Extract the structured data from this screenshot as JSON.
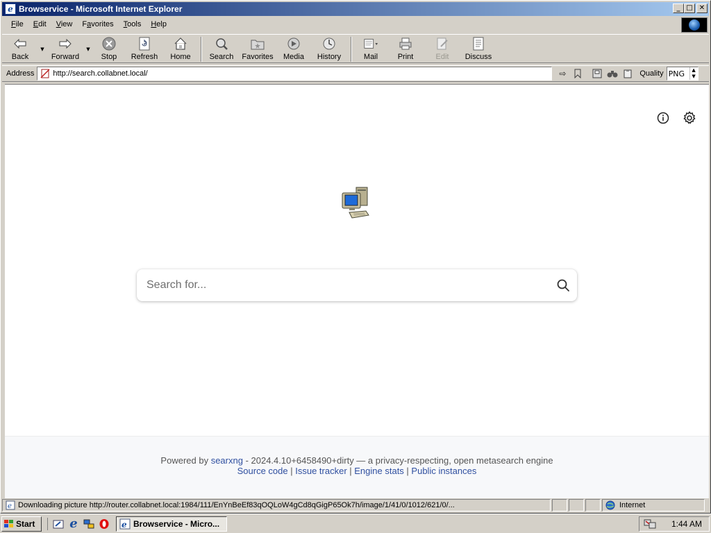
{
  "window": {
    "title": "Browservice - Microsoft Internet Explorer",
    "minimize": "_",
    "maximize": "□",
    "close": "✕"
  },
  "menubar": {
    "items": [
      "File",
      "Edit",
      "View",
      "Favorites",
      "Tools",
      "Help"
    ],
    "underline": [
      "F",
      "E",
      "V",
      "a",
      "T",
      "H"
    ]
  },
  "toolbar": {
    "back": "Back",
    "forward": "Forward",
    "stop": "Stop",
    "refresh": "Refresh",
    "home": "Home",
    "search": "Search",
    "favorites": "Favorites",
    "media": "Media",
    "history": "History",
    "mail": "Mail",
    "print": "Print",
    "edit": "Edit",
    "discuss": "Discuss"
  },
  "address": {
    "label": "Address",
    "url": "http://search.collabnet.local/",
    "quality_label": "Quality",
    "quality_value": "PNG"
  },
  "page": {
    "search_placeholder": "Search for...",
    "footer_powered": "Powered by",
    "footer_searxng": "searxng",
    "footer_version": " - 2024.4.10+6458490+dirty — a privacy-respecting, open metasearch engine",
    "footer_source": "Source code",
    "footer_issue": "Issue tracker",
    "footer_stats": "Engine stats",
    "footer_instances": "Public instances",
    "footer_sep": " | "
  },
  "statusbar": {
    "message": "Downloading picture http://router.collabnet.local:1984/111/EnYnBeEf83qOQLoW4gCd8qGigP65Ok7h/image/1/41/0/1012/621/0/...",
    "zone": "Internet"
  },
  "taskbar": {
    "start": "Start",
    "task_label": "Browservice - Micro...",
    "clock": "1:44 AM"
  }
}
